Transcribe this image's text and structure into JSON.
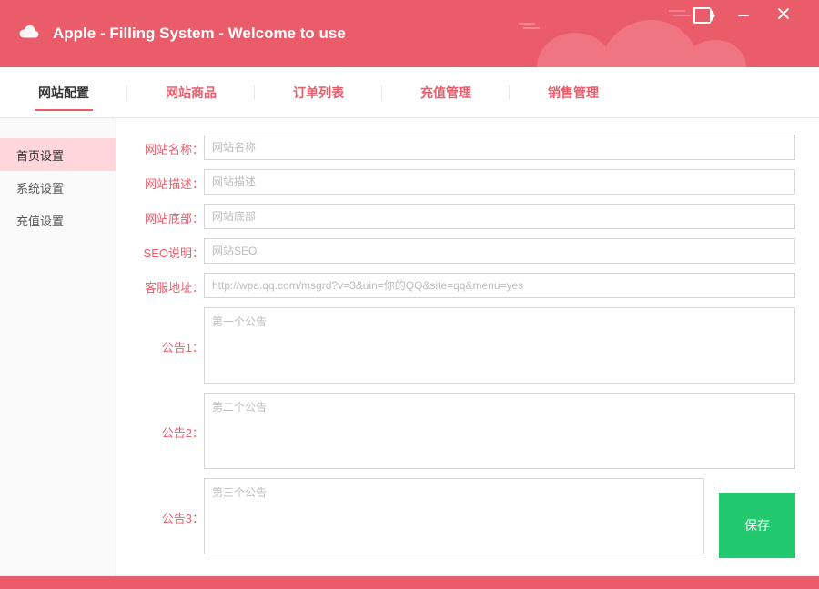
{
  "header": {
    "title": "Apple - Filling System - Welcome to use"
  },
  "tabs": [
    {
      "label": "网站配置",
      "active": true
    },
    {
      "label": "网站商品"
    },
    {
      "label": "订单列表"
    },
    {
      "label": "充值管理"
    },
    {
      "label": "销售管理"
    }
  ],
  "sidebar": [
    {
      "label": "首页设置",
      "active": true
    },
    {
      "label": "系统设置"
    },
    {
      "label": "充值设置"
    }
  ],
  "form": {
    "site_name": {
      "label": "网站名称：",
      "placeholder": "网站名称",
      "value": ""
    },
    "site_desc": {
      "label": "网站描述：",
      "placeholder": "网站描述",
      "value": ""
    },
    "site_footer": {
      "label": "网站底部：",
      "placeholder": "网站底部",
      "value": ""
    },
    "seo": {
      "label": "SEO说明：",
      "placeholder": "网站SEO",
      "value": ""
    },
    "cs_url": {
      "label": "客服地址：",
      "placeholder": "http://wpa.qq.com/msgrd?v=3&uin=你的QQ&site=qq&menu=yes",
      "value": ""
    },
    "notice1": {
      "label": "公告1：",
      "placeholder": "第一个公告",
      "value": ""
    },
    "notice2": {
      "label": "公告2：",
      "placeholder": "第二个公告",
      "value": ""
    },
    "notice3": {
      "label": "公告3：",
      "placeholder": "第三个公告",
      "value": ""
    }
  },
  "buttons": {
    "save": "保存"
  }
}
